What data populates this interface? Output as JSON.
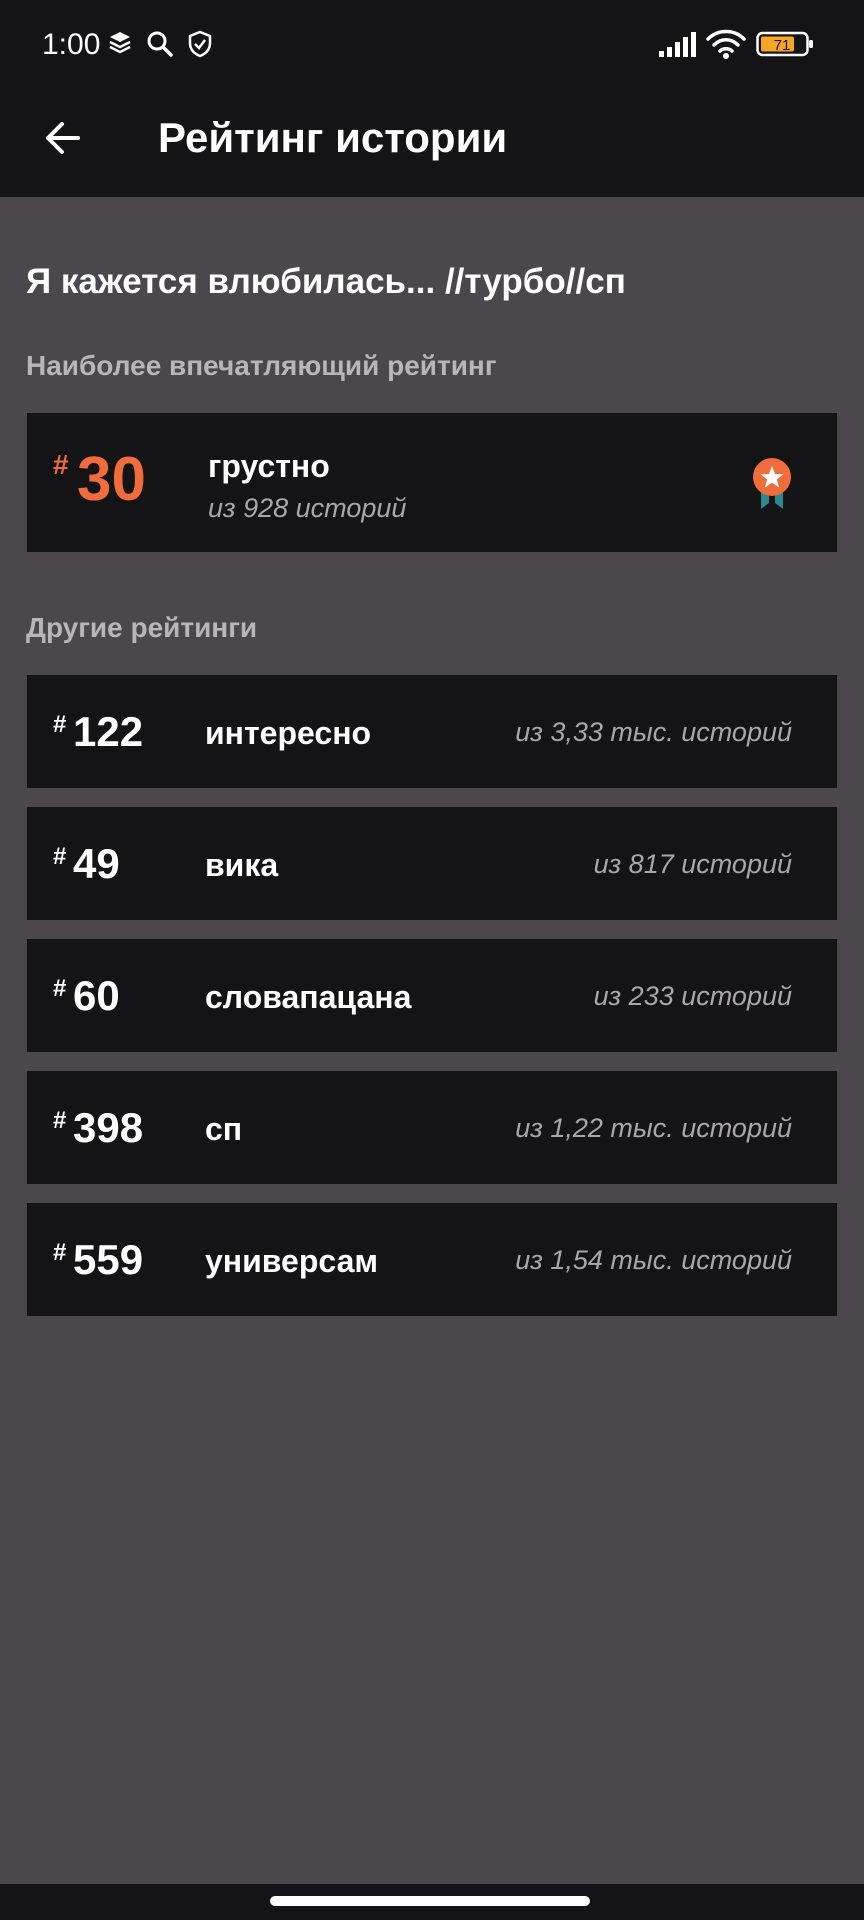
{
  "status_bar": {
    "time": "1:00",
    "battery": "71",
    "icons": [
      "layers-icon",
      "search-icon",
      "shield-icon",
      "signal-icon",
      "wifi-icon",
      "battery-icon"
    ]
  },
  "app_bar": {
    "title": "Рейтинг истории",
    "back_icon": "arrow-left-icon"
  },
  "story": {
    "title": "Я кажется влюбилась... //турбо//сп"
  },
  "best": {
    "section_label": "Наиболее впечатляющий рейтинг",
    "hash": "#",
    "rank": "30",
    "tag": "грустно",
    "count": "из 928 историй",
    "icon": "award-ribbon-icon"
  },
  "others": {
    "section_label": "Другие рейтинги",
    "items": [
      {
        "hash": "#",
        "rank": "122",
        "tag": "интересно",
        "count": "из 3,33 тыс. историй"
      },
      {
        "hash": "#",
        "rank": "49",
        "tag": "вика",
        "count": "из 817 историй"
      },
      {
        "hash": "#",
        "rank": "60",
        "tag": "словапацана",
        "count": "из 233 историй"
      },
      {
        "hash": "#",
        "rank": "398",
        "tag": "сп",
        "count": "из 1,22 тыс. историй"
      },
      {
        "hash": "#",
        "rank": "559",
        "tag": "универсам",
        "count": "из 1,54 тыс. историй"
      }
    ]
  },
  "colors": {
    "accent": "#f06d3b",
    "background": "#4a484c",
    "card": "#141316",
    "muted_text": "#a9a7aa"
  }
}
